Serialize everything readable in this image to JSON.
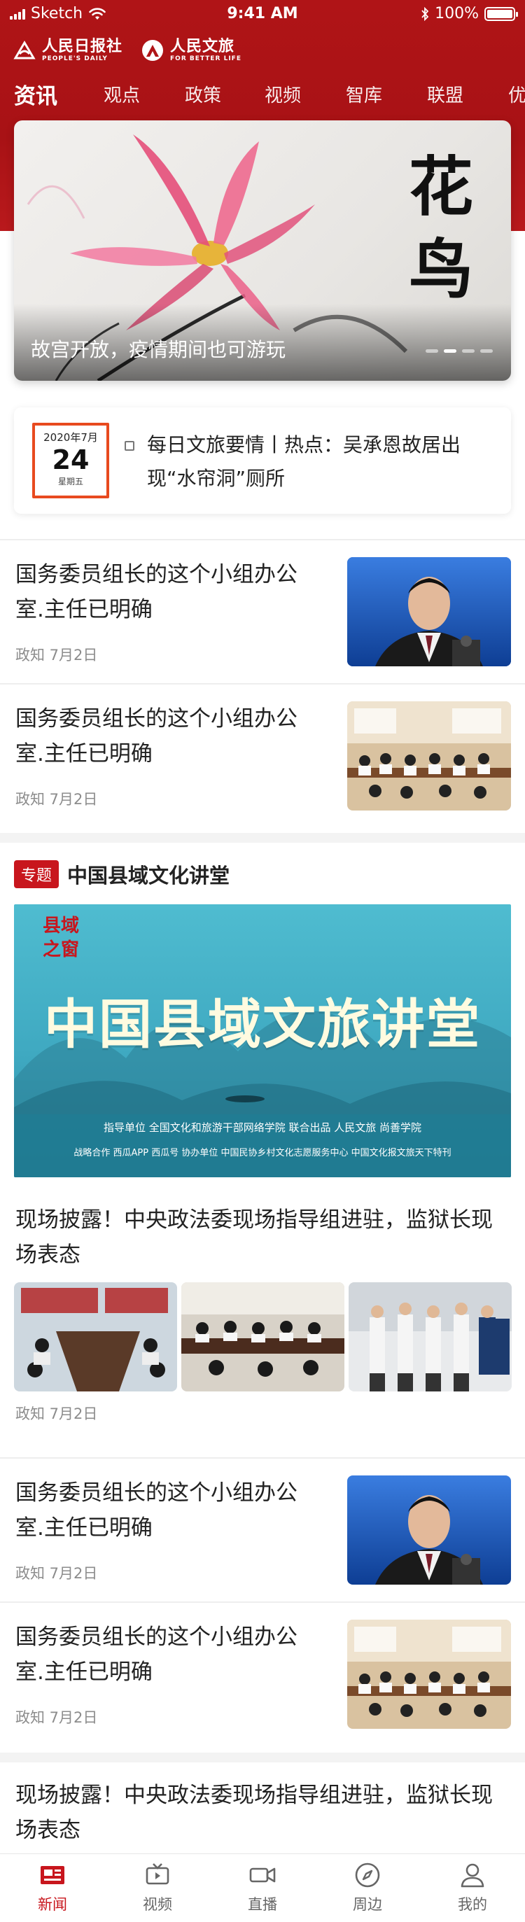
{
  "status_bar": {
    "carrier": "Sketch",
    "time": "9:41 AM",
    "battery": "100%"
  },
  "header": {
    "logo1_cn": "人民日报社",
    "logo1_en": "PEOPLE'S DAILY",
    "logo2_cn": "人民文旅",
    "logo2_en": "FOR BETTER LIFE"
  },
  "tabs": [
    {
      "label": "资讯",
      "active": true
    },
    {
      "label": "观点"
    },
    {
      "label": "政策"
    },
    {
      "label": "视频"
    },
    {
      "label": "智库"
    },
    {
      "label": "联盟"
    },
    {
      "label": "优"
    }
  ],
  "banner": {
    "caption": "故宫开放，疫情期间也可游玩",
    "calligraphy": "花鸟",
    "active_dot": 2,
    "dot_count": 4
  },
  "daily": {
    "year_month": "2020年7月",
    "day": "24",
    "weekday": "星期五",
    "text": "每日文旅要情丨热点：吴承恩故居出现“水帘洞”厕所"
  },
  "news": [
    {
      "title": "国务委员组长的这个小组办公室.主任已明确",
      "meta": "政知 7月2日",
      "thumb": "portrait"
    },
    {
      "title": "国务委员组长的这个小组办公室.主任已明确",
      "meta": "政知 7月2日",
      "thumb": "meeting"
    }
  ],
  "topic": {
    "badge": "专题",
    "name": "中国县域文化讲堂",
    "banner_title": "中国县域文旅讲堂",
    "seal": "县域之窗",
    "footer_line1": "指导单位   全国文化和旅游干部网络学院      联合出品   人民文旅   尚善学院",
    "footer_line2": "战略合作   西瓜APP   西瓜号      协办单位   中国民协乡村文化志愿服务中心   中国文化报文旅天下特刊"
  },
  "triple_news": {
    "title": "现场披露！中央政法委现场指导组进驻，监狱长现场表态",
    "meta": "政知 7月2日"
  },
  "news2": [
    {
      "title": "国务委员组长的这个小组办公室.主任已明确",
      "meta": "政知 7月2日",
      "thumb": "portrait"
    },
    {
      "title": "国务委员组长的这个小组办公室.主任已明确",
      "meta": "政知 7月2日",
      "thumb": "meeting"
    }
  ],
  "last_news": {
    "title": "现场披露！中央政法委现场指导组进驻，监狱长现场表态"
  },
  "bottom_nav": [
    {
      "label": "新闻",
      "icon": "news-icon",
      "active": true
    },
    {
      "label": "视频",
      "icon": "tv-icon"
    },
    {
      "label": "直播",
      "icon": "video-camera-icon"
    },
    {
      "label": "周边",
      "icon": "compass-icon"
    },
    {
      "label": "我的",
      "icon": "user-icon"
    }
  ],
  "colors": {
    "brand_red": "#b01417",
    "date_border": "#e84a1f",
    "badge_red": "#c8161d",
    "meta_gray": "#8c8c8c"
  }
}
